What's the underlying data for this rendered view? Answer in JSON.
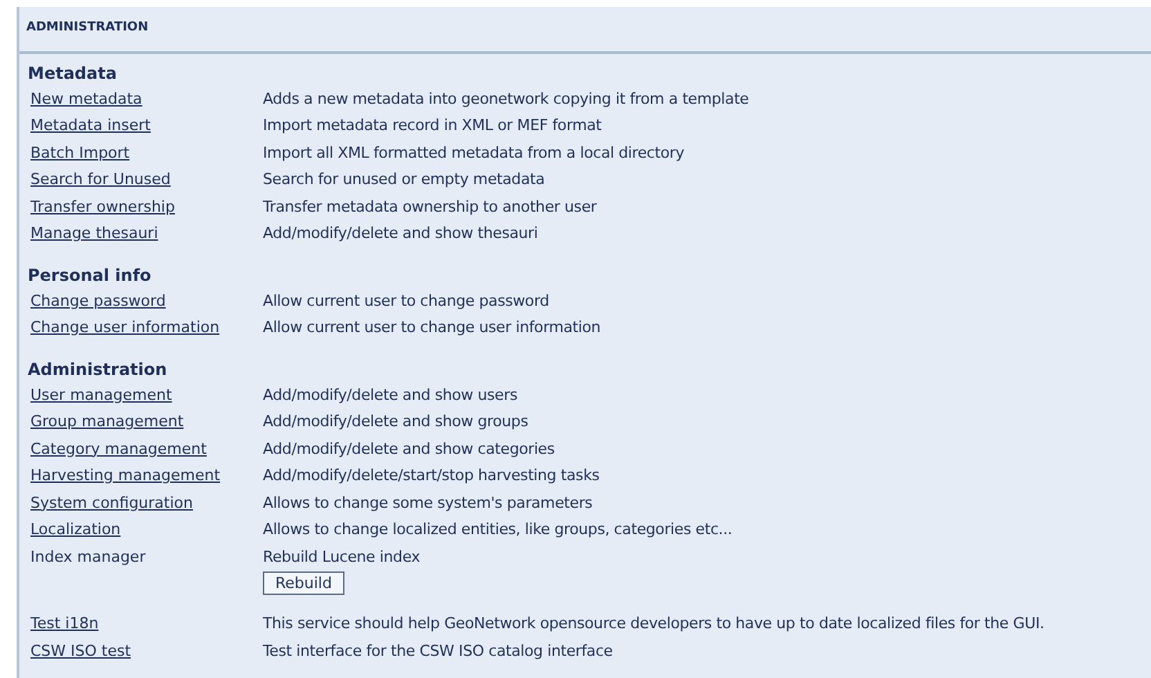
{
  "header": {
    "title": "ADMINISTRATION"
  },
  "sections": [
    {
      "title": "Metadata",
      "items": [
        {
          "kind": "link",
          "label": "New metadata",
          "description": "Adds a new metadata into geonetwork copying it from a template"
        },
        {
          "kind": "link",
          "label": "Metadata insert",
          "description": "Import metadata record in XML or MEF format"
        },
        {
          "kind": "link",
          "label": "Batch Import",
          "description": "Import all XML formatted metadata from a local directory"
        },
        {
          "kind": "link",
          "label": "Search for Unused",
          "description": "Search for unused or empty metadata"
        },
        {
          "kind": "link",
          "label": "Transfer ownership",
          "description": "Transfer metadata ownership to another user"
        },
        {
          "kind": "link",
          "label": "Manage thesauri",
          "description": "Add/modify/delete and show thesauri"
        }
      ]
    },
    {
      "title": "Personal info",
      "items": [
        {
          "kind": "link",
          "label": "Change password",
          "description": "Allow current user to change password"
        },
        {
          "kind": "link",
          "label": "Change user information",
          "description": "Allow current user to change user information"
        }
      ]
    },
    {
      "title": "Administration",
      "items": [
        {
          "kind": "link",
          "label": "User management",
          "description": "Add/modify/delete and show users"
        },
        {
          "kind": "link",
          "label": "Group management",
          "description": "Add/modify/delete and show groups"
        },
        {
          "kind": "link",
          "label": "Category management",
          "description": "Add/modify/delete and show categories"
        },
        {
          "kind": "link",
          "label": "Harvesting management",
          "description": "Add/modify/delete/start/stop harvesting tasks"
        },
        {
          "kind": "link",
          "label": "System configuration",
          "description": "Allows to change some system's parameters"
        },
        {
          "kind": "link",
          "label": "Localization",
          "description": "Allows to change localized entities, like groups, categories etc..."
        },
        {
          "kind": "text",
          "label": "Index manager",
          "description": "Rebuild Lucene index",
          "button": "Rebuild"
        }
      ]
    },
    {
      "items": [
        {
          "kind": "link",
          "label": "Test i18n",
          "description": "This service should help GeoNetwork opensource developers to have up to date localized files for the GUI."
        },
        {
          "kind": "link",
          "label": "CSW ISO test",
          "description": "Test interface for the CSW ISO catalog interface"
        }
      ]
    }
  ]
}
